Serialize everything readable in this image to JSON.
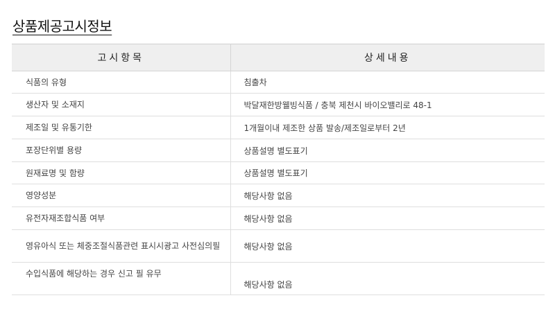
{
  "title": "상품제공고시정보",
  "table": {
    "headers": [
      "고시항목",
      "상세내용"
    ],
    "rows": [
      {
        "item": "식품의 유형",
        "detail": "침출차"
      },
      {
        "item": "생산자 및 소재지",
        "detail": "박달재한방웰빙식품 / 충북 제천시 바이오밸리로 48-1"
      },
      {
        "item": "제조일 및 유통기한",
        "detail": "1개월이내 제조한 상품 발송/제조일로부터 2년"
      },
      {
        "item": "포장단위별 용량",
        "detail": "상품설명 별도표기"
      },
      {
        "item": "원재료명 및 함량",
        "detail": "상품설명 별도표기"
      },
      {
        "item": "영양성분",
        "detail": "해당사항 없음"
      },
      {
        "item": "유전자재조합식품 여부",
        "detail": "해당사항 없음"
      },
      {
        "item": "영유아식 또는 체중조절식품관련 표시시광고 사전심의필",
        "detail": "해당사항 없음"
      },
      {
        "item": "수입식품에 해당하는 경우 신고 필 유무",
        "detail": "해당사항 없음"
      }
    ]
  }
}
